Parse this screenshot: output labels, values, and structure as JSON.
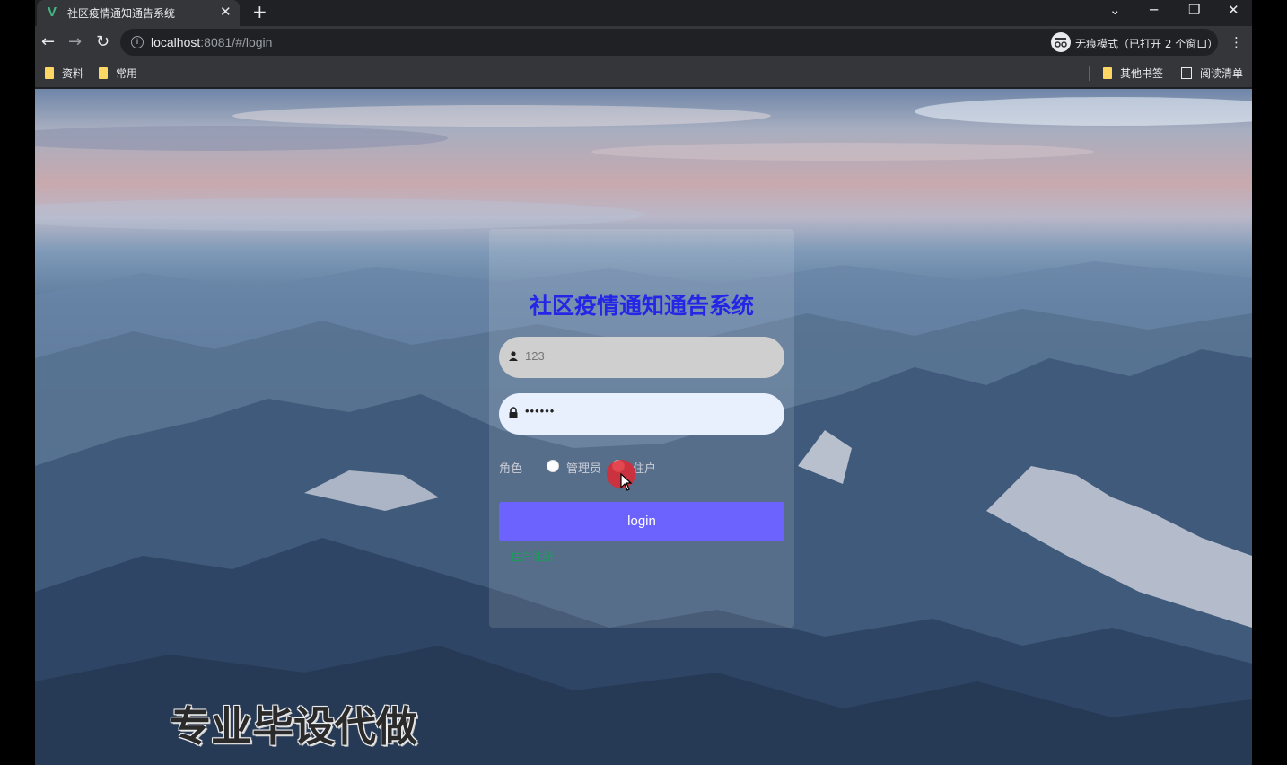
{
  "browser": {
    "tab_title": "社区疫情通知通告系统",
    "tab_favicon": "V",
    "new_tab": "+",
    "url_host": "localhost",
    "url_rest": ":8081/#/login",
    "incognito_label": "无痕模式（已打开 2 个窗口）",
    "bookmarks": [
      "资料",
      "常用"
    ],
    "bookmarks_right": [
      "其他书签",
      "阅读清单"
    ]
  },
  "login": {
    "title": "社区疫情通知通告系统",
    "username_value": "123",
    "password_value": "••••••",
    "role_label": "角色",
    "roles": [
      "管理员",
      "住户"
    ],
    "selected_role": "住户",
    "login_button": "login",
    "register_link": "住户注册"
  },
  "watermark": "专业毕设代做",
  "colors": {
    "title": "#2525e6",
    "login_button": "#6c63ff",
    "link": "#18a058"
  }
}
